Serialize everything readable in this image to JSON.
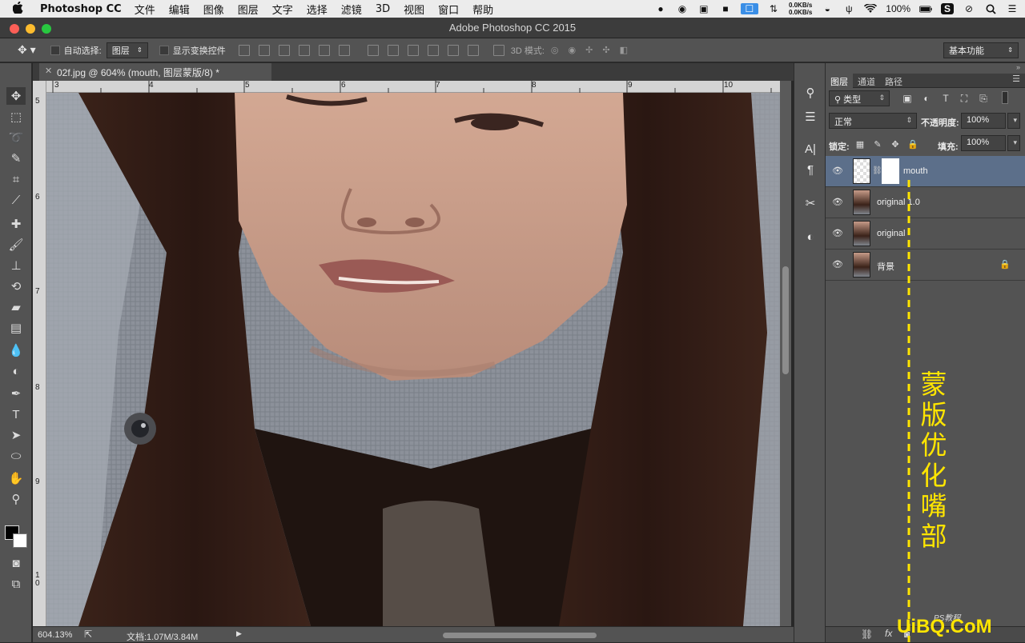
{
  "menubar": {
    "apple": "",
    "app_name": "Photoshop CC",
    "items": [
      "文件",
      "编辑",
      "图像",
      "图层",
      "文字",
      "选择",
      "滤镜",
      "3D",
      "视图",
      "窗口",
      "帮助"
    ],
    "net_up": "0.0KB/s",
    "net_down": "0.0KB/s",
    "battery": "100%"
  },
  "window": {
    "title": "Adobe Photoshop CC 2015"
  },
  "options_bar": {
    "auto_select_label": "自动选择:",
    "auto_select_target": "图层",
    "show_transform_label": "显示变换控件",
    "mode_3d_label": "3D 模式:",
    "workspace": "基本功能"
  },
  "document": {
    "tab_title": "02f.jpg @ 604% (mouth, 图层蒙版/8) *",
    "ruler_top_ticks": [
      "3",
      "4",
      "5",
      "6",
      "7",
      "8",
      "9",
      "10"
    ],
    "ruler_left_ticks": [
      "5",
      "6",
      "7",
      "8",
      "9",
      "1\n0"
    ]
  },
  "status_bar": {
    "zoom": "604.13%",
    "doc_size": "文档:1.07M/3.84M"
  },
  "panel": {
    "tabs": [
      "图层",
      "通道",
      "路径"
    ],
    "filter_kind": "类型",
    "blend_mode": "正常",
    "opacity_label": "不透明度:",
    "opacity_value": "100%",
    "lock_label": "锁定:",
    "fill_label": "填充:",
    "fill_value": "100%",
    "layers": [
      {
        "name": "mouth",
        "selected": true,
        "has_mask": true
      },
      {
        "name": "original 1.0",
        "selected": false
      },
      {
        "name": "original",
        "selected": false
      },
      {
        "name": "背景",
        "selected": false,
        "locked": true
      }
    ]
  },
  "annotation": {
    "text": "蒙版优化嘴部",
    "color": "#ffe500"
  },
  "watermark": {
    "main": "UiBQ.CoM",
    "small": "PS教程"
  },
  "colors": {
    "selected_layer": "#5c6f8a",
    "annotation": "#ffe500",
    "ui_gray": "#535353"
  }
}
